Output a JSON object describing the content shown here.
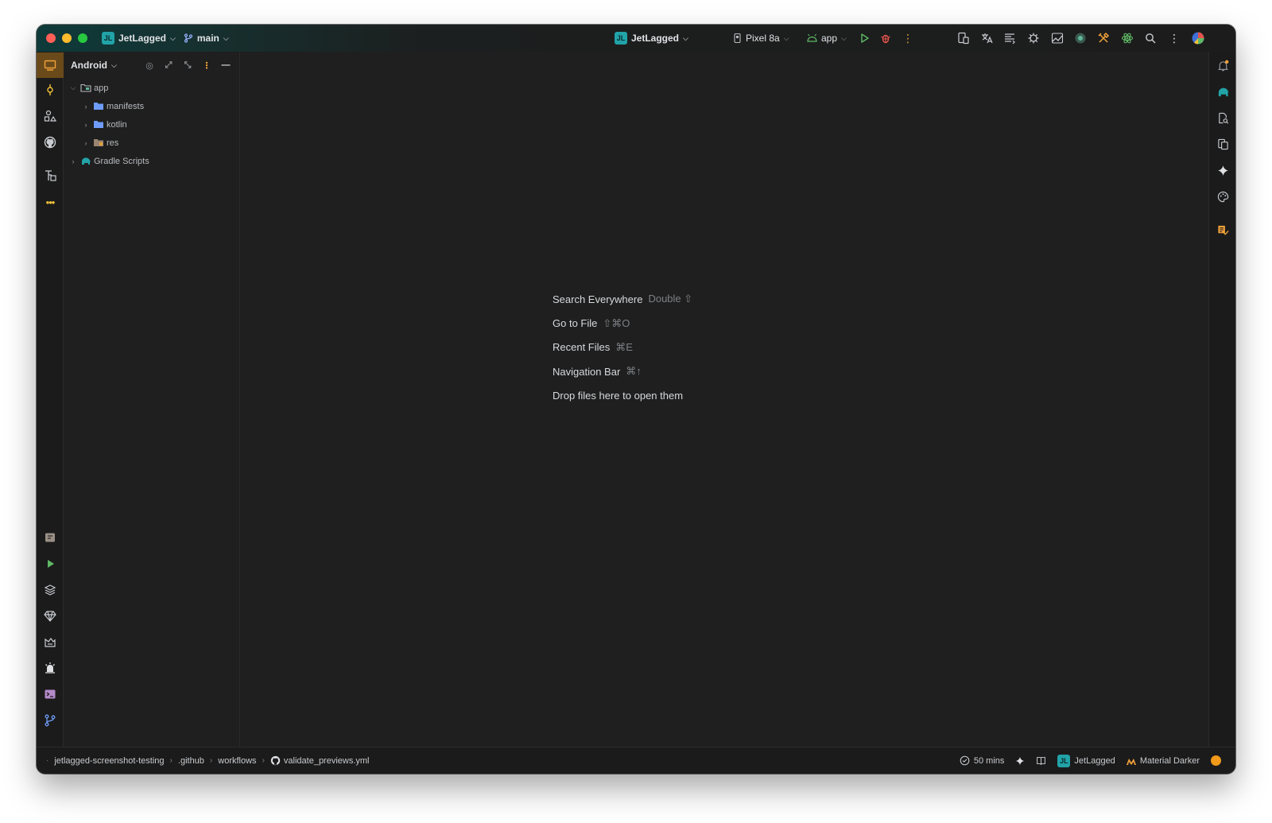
{
  "titlebar": {
    "project_badge": "JL",
    "project_name": "JetLagged",
    "branch": "main",
    "center_project": "JetLagged",
    "device": "Pixel 8a",
    "run_config": "app"
  },
  "project_panel": {
    "view_mode": "Android",
    "tree": [
      {
        "label": "app",
        "level": 0,
        "expanded": true
      },
      {
        "label": "manifests",
        "level": 1,
        "expanded": false
      },
      {
        "label": "kotlin",
        "level": 1,
        "expanded": false
      },
      {
        "label": "res",
        "level": 1,
        "expanded": false
      },
      {
        "label": "Gradle Scripts",
        "level": 0,
        "expanded": false
      }
    ]
  },
  "editor_hints": [
    {
      "label": "Search Everywhere",
      "shortcut": "Double ⇧"
    },
    {
      "label": "Go to File",
      "shortcut": "⇧⌘O"
    },
    {
      "label": "Recent Files",
      "shortcut": "⌘E"
    },
    {
      "label": "Navigation Bar",
      "shortcut": "⌘↑"
    },
    {
      "label": "Drop files here to open them",
      "shortcut": ""
    }
  ],
  "statusbar": {
    "breadcrumbs": [
      "jetlagged-screenshot-testing",
      ".github",
      "workflows",
      "validate_previews.yml"
    ],
    "timer": "50 mins",
    "project_badge": "JL",
    "project": "JetLagged",
    "theme": "Material Darker"
  },
  "colors": {
    "accent_orange": "#f2a23a",
    "folder_blue": "#6e9cf7",
    "run_green": "#5fb865",
    "debug_red": "#e5534b",
    "teal": "#21a3a8"
  }
}
